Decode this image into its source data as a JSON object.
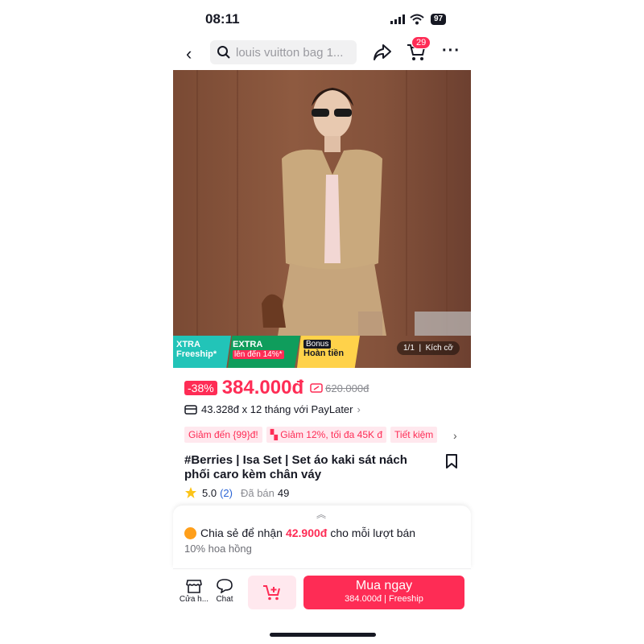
{
  "status": {
    "time": "08:11",
    "battery": "97"
  },
  "nav": {
    "search_text": "louis vuitton bag 1...",
    "cart_count": "29"
  },
  "promo": {
    "p1_title": "XTRA",
    "p1_sub": "Freeship*",
    "p2_title": "EXTRA",
    "p2_sub": "lên đến 14%*",
    "p3_tag": "Bonus",
    "p3_sub": "Hoàn tiền"
  },
  "photo": {
    "counter": "1/1",
    "size_label": "Kích cỡ"
  },
  "price": {
    "discount": "-38%",
    "current": "384.000đ",
    "original": "620.000đ"
  },
  "paylater": "43.328đ x 12 tháng với PayLater",
  "chips": [
    "Giảm đến {99}đ!",
    "Giảm 12%, tối đa 45K đ",
    "Tiết kiệm"
  ],
  "product": {
    "title": "#Berries | Isa Set | Set áo kaki sát nách phối caro kèm chân váy",
    "rating": "5.0",
    "rating_count": "(2)",
    "sold_label": "Đã bán",
    "sold_count": "49"
  },
  "affiliate": {
    "prefix": "Chia sẻ để nhận",
    "amount": "42.900đ",
    "suffix": "cho mỗi lượt bán",
    "commission": "10% hoa hồng"
  },
  "bottom": {
    "shop_label": "Cửa h...",
    "chat_label": "Chat",
    "buy_label": "Mua ngay",
    "buy_sub": "384.000đ | Freeship"
  },
  "colors": {
    "accent": "#fe2c55",
    "promo_teal": "#22c4b8",
    "promo_green": "#0f9d5c",
    "promo_yellow": "#ffd24a"
  }
}
